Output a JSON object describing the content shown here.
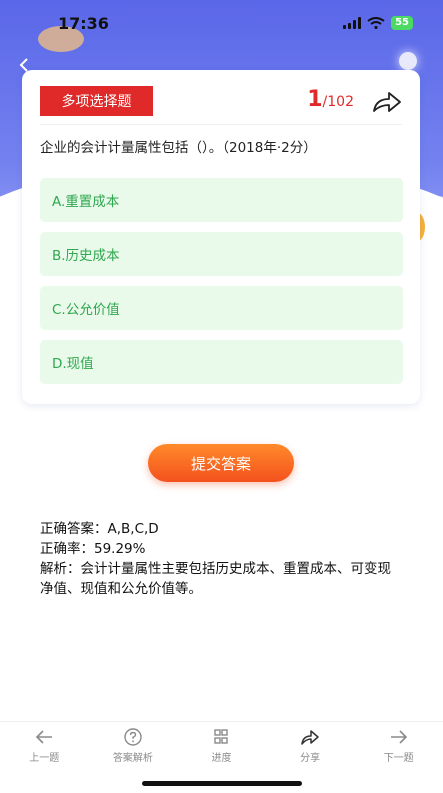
{
  "status_bar": {
    "time": "17:36",
    "battery": "55"
  },
  "question_card": {
    "type_label": "多项选择题",
    "counter_current": "1",
    "counter_total": "/102",
    "question_text": "企业的会计计量属性包括（）。（2018年·2分）",
    "options": [
      {
        "label": "A.重置成本"
      },
      {
        "label": "B.历史成本"
      },
      {
        "label": "C.公允价值"
      },
      {
        "label": "D.现值"
      }
    ]
  },
  "submit_button": {
    "label": "提交答案"
  },
  "analysis": {
    "correct_answer": "正确答案：A,B,C,D",
    "accuracy": "正确率：59.29%",
    "explanation": "解析：会计计量属性主要包括历史成本、重置成本、可变现净值、现值和公允价值等。"
  },
  "tabbar": {
    "items": [
      {
        "label": "上一题",
        "icon": "arrow-left-icon"
      },
      {
        "label": "答案解析",
        "icon": "question-circle-icon"
      },
      {
        "label": "进度",
        "icon": "grid-icon"
      },
      {
        "label": "分享",
        "icon": "share-icon"
      },
      {
        "label": "下一题",
        "icon": "arrow-right-icon"
      }
    ]
  },
  "colors": {
    "accent_red": "#e02a2a",
    "option_green": "#2fa84f",
    "option_bg": "#e9f9ea",
    "submit_orange": "#f4511e",
    "header_blue": "#5a67e8"
  }
}
